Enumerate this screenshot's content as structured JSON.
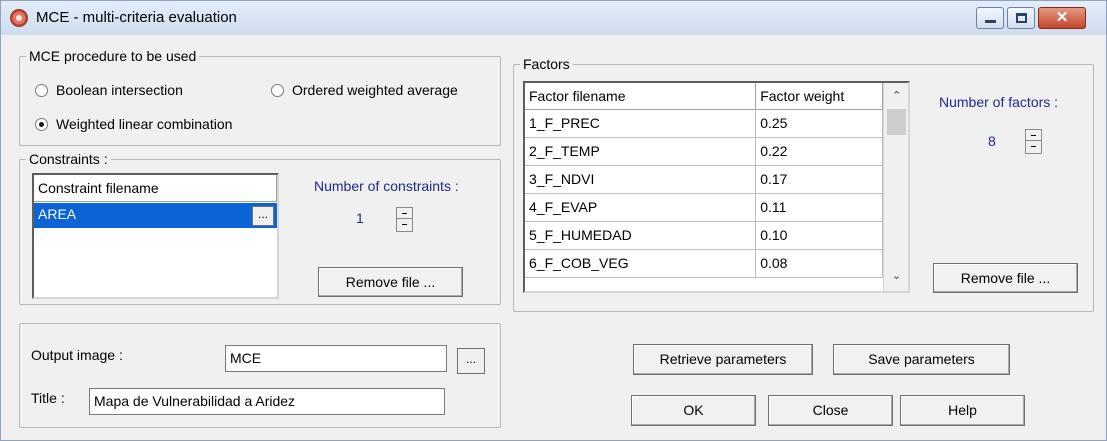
{
  "window": {
    "title": "MCE - multi-criteria evaluation",
    "controls": {
      "minimize": "—",
      "maximize": "□",
      "close": "✕"
    }
  },
  "procedure": {
    "label": "MCE procedure to be used",
    "options": [
      {
        "label": "Boolean intersection",
        "selected": false
      },
      {
        "label": "Ordered weighted average",
        "selected": false
      },
      {
        "label": "Weighted linear combination",
        "selected": true
      }
    ]
  },
  "constraints": {
    "label": "Constraints :",
    "column_header": "Constraint filename",
    "files": [
      "AREA"
    ],
    "browse_label": "...",
    "count_label": "Number of constraints :",
    "count": "1",
    "remove_label": "Remove file ..."
  },
  "factors": {
    "label": "Factors",
    "columns": [
      "Factor filename",
      "Factor weight"
    ],
    "rows": [
      [
        "1_F_PREC",
        "0.25"
      ],
      [
        "2_F_TEMP",
        "0.22"
      ],
      [
        "3_F_NDVI",
        "0.17"
      ],
      [
        "4_F_EVAP",
        "0.11"
      ],
      [
        "5_F_HUMEDAD",
        "0.10"
      ],
      [
        "6_F_COB_VEG",
        "0.08"
      ]
    ],
    "count_label": "Number of factors :",
    "count": "8",
    "remove_label": "Remove file ..."
  },
  "output": {
    "image_label": "Output image :",
    "image_value": "MCE",
    "browse_label": "...",
    "title_label": "Title :",
    "title_value": "Mapa de Vulnerabilidad a Aridez"
  },
  "buttons": {
    "retrieve": "Retrieve parameters",
    "save": "Save parameters",
    "ok": "OK",
    "close": "Close",
    "help": "Help"
  },
  "icons": {
    "app": "idrisi-app-icon",
    "scroll_up": "chevron-up-icon",
    "scroll_down": "chevron-down-icon"
  }
}
